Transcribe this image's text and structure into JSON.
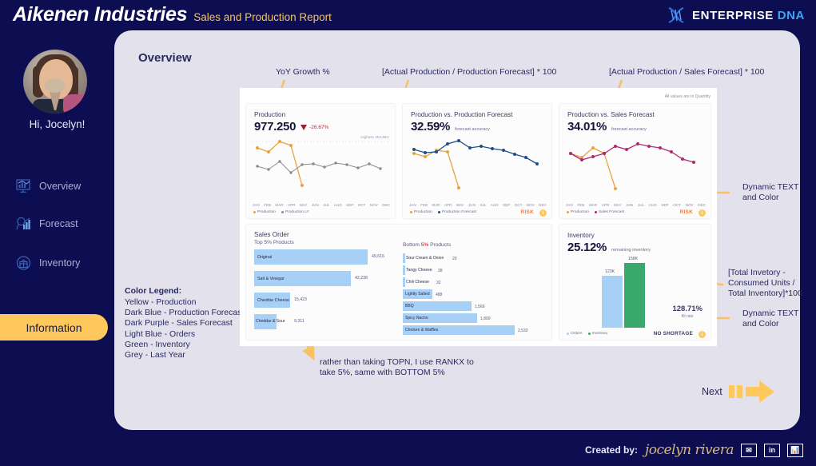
{
  "header": {
    "brand_name": "Aikenen Industries",
    "brand_subtitle": "Sales and Production Report",
    "logo_word1": "ENTERPRISE",
    "logo_word2": "DNA"
  },
  "sidebar": {
    "greeting": "Hi, Jocelyn!",
    "items": [
      {
        "label": "Overview",
        "icon": "monitor-chart-icon"
      },
      {
        "label": "Forecast",
        "icon": "magnifier-bar-chart-icon"
      },
      {
        "label": "Inventory",
        "icon": "box-circle-icon"
      }
    ],
    "active_button": "Information"
  },
  "panel": {
    "title": "Overview",
    "next_label": "Next"
  },
  "annotations": {
    "yoy": "YoY Growth %",
    "production_forecast_formula": "[Actual Production / Production Forecast] * 100",
    "sales_forecast_formula": "[Actual Production / Sales Forecast] * 100",
    "dynamic_text_1": "Dynamic TEXT and Color",
    "inventory_formula": "[Total Invetory - Consumed Units / Total Inventory]*100",
    "dynamic_text_2": "Dynamic TEXT and Color",
    "rankx_note": "rather than taking TOPN,  I use RANKX to take 5%, same with BOTTOM 5%"
  },
  "color_legend": {
    "title": "Color Legend:",
    "items": [
      "Yellow - Production",
      "Dark Blue - Production Forecast",
      "Dark Purple - Sales Forecast",
      "Light Blue - Orders",
      "Green - Inventory",
      "Grey - Last Year"
    ]
  },
  "dashboard": {
    "quantity_note": "All values are in Quantity",
    "months": [
      "JAN",
      "FEB",
      "MAR",
      "APR",
      "MAY",
      "JUN",
      "JUL",
      "AUG",
      "SEP",
      "OCT",
      "NOV",
      "DEC"
    ],
    "production_card": {
      "title": "Production",
      "value": "977.250",
      "delta": "-26.67%",
      "highest_note": "Highest: 254,894",
      "legend": [
        "Production",
        "Production LY"
      ],
      "risk_label": ""
    },
    "production_forecast_card": {
      "title": "Production vs. Production Forecast",
      "value": "32.59%",
      "value_sub": "forecast accuracy",
      "legend": [
        "Production",
        "Production Forecast"
      ],
      "risk_label": "RISK"
    },
    "sales_forecast_card": {
      "title": "Production vs. Sales Forecast",
      "value": "34.01%",
      "value_sub": "forecast accuracy",
      "legend": [
        "Production",
        "Sales Forecast"
      ],
      "risk_label": "RISK"
    },
    "sales_order_card": {
      "title": "Sales Order",
      "top_subtitle": "Top 5% Products",
      "bottom_subtitle_pre": "Bottom ",
      "bottom_subtitle_pct": "5%",
      "bottom_subtitle_post": " Products"
    },
    "inventory_card": {
      "title": "Inventory",
      "value": "25.12%",
      "value_sub": "remaining inventory",
      "fill_rate_value": "128.71%",
      "fill_rate_label": "fill rate",
      "shortage_status": "NO SHORTAGE",
      "legend": [
        "Orders",
        "Inventory"
      ]
    }
  },
  "chart_data": [
    {
      "type": "line",
      "title": "Production",
      "categories": [
        "JAN",
        "FEB",
        "MAR",
        "APR",
        "MAY",
        "JUN",
        "JUL",
        "AUG",
        "SEP",
        "OCT",
        "NOV",
        "DEC"
      ],
      "series": [
        {
          "name": "Production",
          "color": "#e8a33d",
          "values": [
            196000,
            186000,
            222000,
            205000,
            22000,
            null,
            null,
            null,
            null,
            null,
            null,
            null
          ]
        },
        {
          "name": "Production LY",
          "color": "#8c8c8c",
          "values": [
            118000,
            104000,
            140000,
            88000,
            122000,
            126000,
            112000,
            130000,
            124000,
            110000,
            126000,
            104000
          ]
        }
      ],
      "ylim": [
        0,
        260000
      ],
      "annotation": "Highest: 254,894",
      "legend_position": "bottom-left"
    },
    {
      "type": "line",
      "title": "Production vs. Production Forecast",
      "categories": [
        "JAN",
        "FEB",
        "MAR",
        "APR",
        "MAY",
        "JUN",
        "JUL",
        "AUG",
        "SEP",
        "OCT",
        "NOV",
        "DEC"
      ],
      "series": [
        {
          "name": "Production",
          "color": "#e8a33d",
          "values": [
            180000,
            168000,
            196000,
            188000,
            18000,
            null,
            null,
            null,
            null,
            null,
            null,
            null
          ]
        },
        {
          "name": "Production Forecast",
          "color": "#1b4f8c",
          "values": [
            200000,
            188000,
            192000,
            222000,
            232000,
            208000,
            212000,
            204000,
            198000,
            184000,
            172000,
            152000
          ]
        }
      ],
      "ylim": [
        0,
        250000
      ],
      "legend_position": "bottom-left"
    },
    {
      "type": "line",
      "title": "Production vs. Sales Forecast",
      "categories": [
        "JAN",
        "FEB",
        "MAR",
        "APR",
        "MAY",
        "JUN",
        "JUL",
        "AUG",
        "SEP",
        "OCT",
        "NOV",
        "DEC"
      ],
      "series": [
        {
          "name": "Production",
          "color": "#e8a33d",
          "values": [
            186000,
            172000,
            204000,
            188000,
            16000,
            null,
            null,
            null,
            null,
            null,
            null,
            null
          ]
        },
        {
          "name": "Sales Forecast",
          "color": "#b02a6e",
          "values": [
            186000,
            160000,
            172000,
            188000,
            208000,
            198000,
            214000,
            206000,
            200000,
            186000,
            164000,
            152000
          ]
        }
      ],
      "ylim": [
        0,
        230000
      ],
      "legend_position": "bottom-left"
    },
    {
      "type": "bar",
      "title": "Top 5% Products",
      "orientation": "horizontal",
      "categories": [
        "Original",
        "Salt & Vinegar",
        "Cheddar Cheese",
        "Cheddar & Sour"
      ],
      "values": [
        49616,
        42238,
        15423,
        9311
      ],
      "value_labels": [
        "49,616",
        "42,238",
        "15,423",
        "9,311"
      ],
      "color": "#a7d0f7"
    },
    {
      "type": "bar",
      "title": "Bottom 5% Products",
      "orientation": "horizontal",
      "categories": [
        "Sour Cream & Onion",
        "Tangy Cheese",
        "Chili Cheese",
        "Lightly Salted",
        "BBQ",
        "Spicy Nacho",
        "Chicken & Waffles"
      ],
      "values": [
        20,
        28,
        32,
        488,
        1569,
        1800,
        2533
      ],
      "value_labels": [
        "20",
        "28",
        "32",
        "488",
        "1,569",
        "1,800",
        "2,533"
      ],
      "color": "#a7d0f7"
    },
    {
      "type": "bar",
      "title": "Inventory",
      "categories": [
        "Orders",
        "Inventory"
      ],
      "values": [
        123000,
        158000
      ],
      "value_labels": [
        "123K",
        "158K"
      ],
      "colors": [
        "#a7d0f7",
        "#3aa86a"
      ]
    }
  ],
  "footer": {
    "created_label": "Created by:",
    "signature": "jocelyn rivera",
    "icons": [
      "envelope-icon",
      "linkedin-icon",
      "bar-chart-icon"
    ]
  }
}
